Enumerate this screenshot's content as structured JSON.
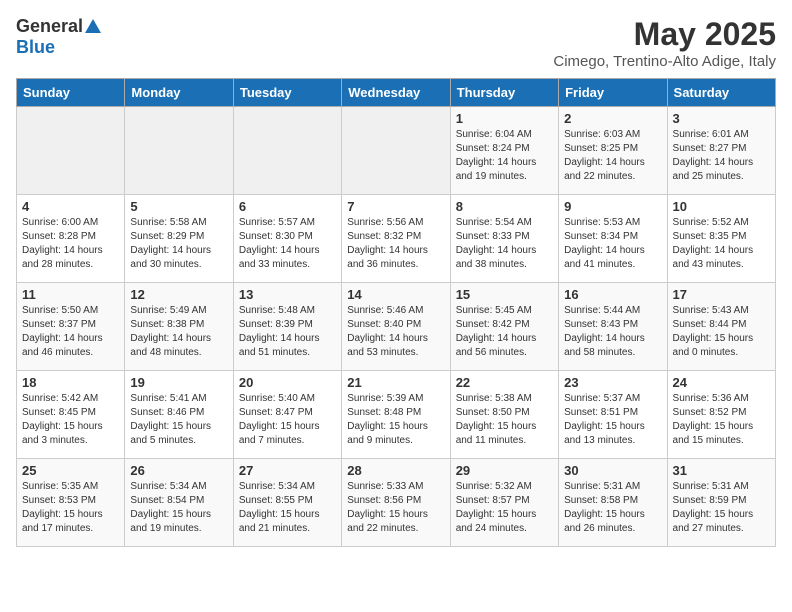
{
  "header": {
    "logo_general": "General",
    "logo_blue": "Blue",
    "month_title": "May 2025",
    "subtitle": "Cimego, Trentino-Alto Adige, Italy"
  },
  "days_of_week": [
    "Sunday",
    "Monday",
    "Tuesday",
    "Wednesday",
    "Thursday",
    "Friday",
    "Saturday"
  ],
  "weeks": [
    [
      {
        "day": "",
        "info": ""
      },
      {
        "day": "",
        "info": ""
      },
      {
        "day": "",
        "info": ""
      },
      {
        "day": "",
        "info": ""
      },
      {
        "day": "1",
        "info": "Sunrise: 6:04 AM\nSunset: 8:24 PM\nDaylight: 14 hours\nand 19 minutes."
      },
      {
        "day": "2",
        "info": "Sunrise: 6:03 AM\nSunset: 8:25 PM\nDaylight: 14 hours\nand 22 minutes."
      },
      {
        "day": "3",
        "info": "Sunrise: 6:01 AM\nSunset: 8:27 PM\nDaylight: 14 hours\nand 25 minutes."
      }
    ],
    [
      {
        "day": "4",
        "info": "Sunrise: 6:00 AM\nSunset: 8:28 PM\nDaylight: 14 hours\nand 28 minutes."
      },
      {
        "day": "5",
        "info": "Sunrise: 5:58 AM\nSunset: 8:29 PM\nDaylight: 14 hours\nand 30 minutes."
      },
      {
        "day": "6",
        "info": "Sunrise: 5:57 AM\nSunset: 8:30 PM\nDaylight: 14 hours\nand 33 minutes."
      },
      {
        "day": "7",
        "info": "Sunrise: 5:56 AM\nSunset: 8:32 PM\nDaylight: 14 hours\nand 36 minutes."
      },
      {
        "day": "8",
        "info": "Sunrise: 5:54 AM\nSunset: 8:33 PM\nDaylight: 14 hours\nand 38 minutes."
      },
      {
        "day": "9",
        "info": "Sunrise: 5:53 AM\nSunset: 8:34 PM\nDaylight: 14 hours\nand 41 minutes."
      },
      {
        "day": "10",
        "info": "Sunrise: 5:52 AM\nSunset: 8:35 PM\nDaylight: 14 hours\nand 43 minutes."
      }
    ],
    [
      {
        "day": "11",
        "info": "Sunrise: 5:50 AM\nSunset: 8:37 PM\nDaylight: 14 hours\nand 46 minutes."
      },
      {
        "day": "12",
        "info": "Sunrise: 5:49 AM\nSunset: 8:38 PM\nDaylight: 14 hours\nand 48 minutes."
      },
      {
        "day": "13",
        "info": "Sunrise: 5:48 AM\nSunset: 8:39 PM\nDaylight: 14 hours\nand 51 minutes."
      },
      {
        "day": "14",
        "info": "Sunrise: 5:46 AM\nSunset: 8:40 PM\nDaylight: 14 hours\nand 53 minutes."
      },
      {
        "day": "15",
        "info": "Sunrise: 5:45 AM\nSunset: 8:42 PM\nDaylight: 14 hours\nand 56 minutes."
      },
      {
        "day": "16",
        "info": "Sunrise: 5:44 AM\nSunset: 8:43 PM\nDaylight: 14 hours\nand 58 minutes."
      },
      {
        "day": "17",
        "info": "Sunrise: 5:43 AM\nSunset: 8:44 PM\nDaylight: 15 hours\nand 0 minutes."
      }
    ],
    [
      {
        "day": "18",
        "info": "Sunrise: 5:42 AM\nSunset: 8:45 PM\nDaylight: 15 hours\nand 3 minutes."
      },
      {
        "day": "19",
        "info": "Sunrise: 5:41 AM\nSunset: 8:46 PM\nDaylight: 15 hours\nand 5 minutes."
      },
      {
        "day": "20",
        "info": "Sunrise: 5:40 AM\nSunset: 8:47 PM\nDaylight: 15 hours\nand 7 minutes."
      },
      {
        "day": "21",
        "info": "Sunrise: 5:39 AM\nSunset: 8:48 PM\nDaylight: 15 hours\nand 9 minutes."
      },
      {
        "day": "22",
        "info": "Sunrise: 5:38 AM\nSunset: 8:50 PM\nDaylight: 15 hours\nand 11 minutes."
      },
      {
        "day": "23",
        "info": "Sunrise: 5:37 AM\nSunset: 8:51 PM\nDaylight: 15 hours\nand 13 minutes."
      },
      {
        "day": "24",
        "info": "Sunrise: 5:36 AM\nSunset: 8:52 PM\nDaylight: 15 hours\nand 15 minutes."
      }
    ],
    [
      {
        "day": "25",
        "info": "Sunrise: 5:35 AM\nSunset: 8:53 PM\nDaylight: 15 hours\nand 17 minutes."
      },
      {
        "day": "26",
        "info": "Sunrise: 5:34 AM\nSunset: 8:54 PM\nDaylight: 15 hours\nand 19 minutes."
      },
      {
        "day": "27",
        "info": "Sunrise: 5:34 AM\nSunset: 8:55 PM\nDaylight: 15 hours\nand 21 minutes."
      },
      {
        "day": "28",
        "info": "Sunrise: 5:33 AM\nSunset: 8:56 PM\nDaylight: 15 hours\nand 22 minutes."
      },
      {
        "day": "29",
        "info": "Sunrise: 5:32 AM\nSunset: 8:57 PM\nDaylight: 15 hours\nand 24 minutes."
      },
      {
        "day": "30",
        "info": "Sunrise: 5:31 AM\nSunset: 8:58 PM\nDaylight: 15 hours\nand 26 minutes."
      },
      {
        "day": "31",
        "info": "Sunrise: 5:31 AM\nSunset: 8:59 PM\nDaylight: 15 hours\nand 27 minutes."
      }
    ]
  ]
}
